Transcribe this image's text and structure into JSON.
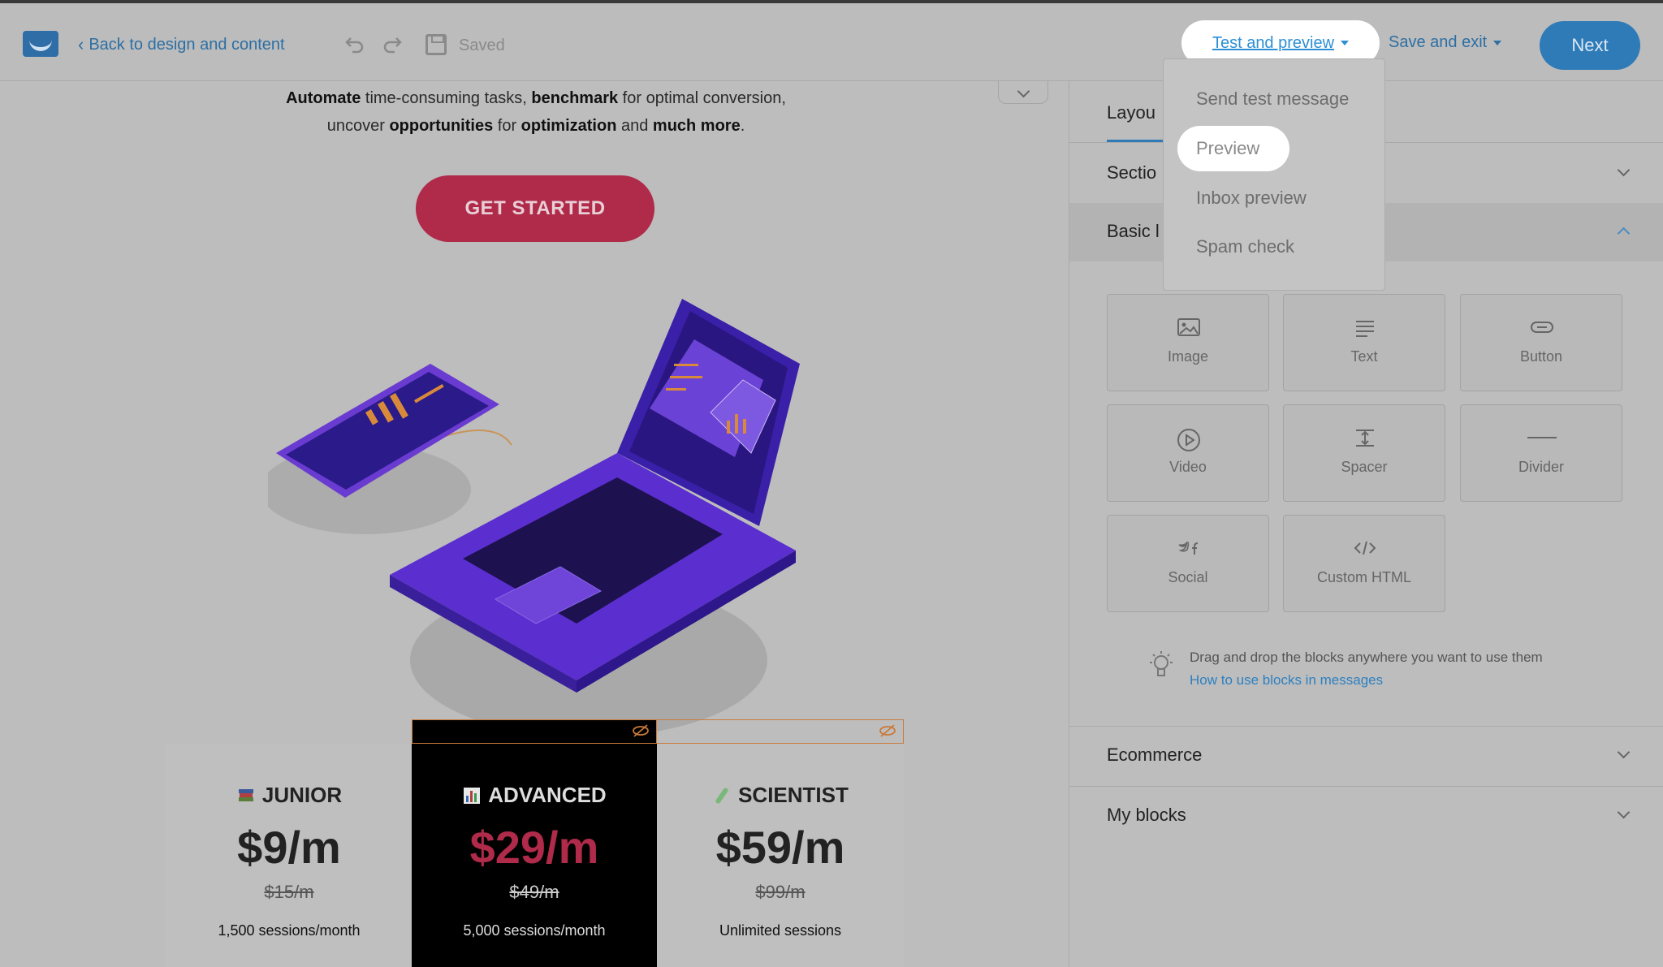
{
  "topbar": {
    "back_label": "Back to design and content",
    "saved_label": "Saved",
    "test_preview_label": "Test and preview",
    "save_exit_label": "Save and exit",
    "next_label": "Next"
  },
  "dropdown": {
    "items": [
      "Send test message",
      "Preview",
      "Inbox preview",
      "Spam check"
    ],
    "highlighted": "Preview"
  },
  "canvas": {
    "intro_line1": [
      "Automate",
      " time-consuming tasks, ",
      "benchmark",
      " for optimal conversion,"
    ],
    "intro_line2": [
      "uncover ",
      "opportunities",
      " for ",
      "optimization",
      " and ",
      "much more",
      "."
    ],
    "cta_label": "GET STARTED"
  },
  "plans": [
    {
      "name": "JUNIOR",
      "icon": "books-icon",
      "price": "$9/m",
      "old_price": "$15/m",
      "sessions": "1,500 sessions/month"
    },
    {
      "name": "ADVANCED",
      "icon": "bar-chart-icon",
      "price": "$29/m",
      "old_price": "$49/m",
      "sessions": "5,000 sessions/month"
    },
    {
      "name": "SCIENTIST",
      "icon": "test-tube-icon",
      "price": "$59/m",
      "old_price": "$99/m",
      "sessions": "Unlimited sessions"
    }
  ],
  "panel": {
    "tab_layout": "Layou",
    "section_label": "Sectio",
    "basic_label": "Basic l",
    "blocks": [
      {
        "label": "Image",
        "icon": "image-icon"
      },
      {
        "label": "Text",
        "icon": "text-icon"
      },
      {
        "label": "Button",
        "icon": "button-icon"
      },
      {
        "label": "Video",
        "icon": "play-icon"
      },
      {
        "label": "Spacer",
        "icon": "spacer-icon"
      },
      {
        "label": "Divider",
        "icon": "divider-icon"
      },
      {
        "label": "Social",
        "icon": "social-icon"
      },
      {
        "label": "Custom HTML",
        "icon": "code-icon"
      }
    ],
    "tip_text": "Drag and drop the blocks anywhere you want to use them",
    "tip_link": "How to use blocks in messages",
    "ecommerce_label": "Ecommerce",
    "my_blocks_label": "My blocks"
  },
  "colors": {
    "accent_blue": "#2f7bb8",
    "cta_red": "#b02a4a",
    "overlay_gray": "#bdbdbd"
  }
}
